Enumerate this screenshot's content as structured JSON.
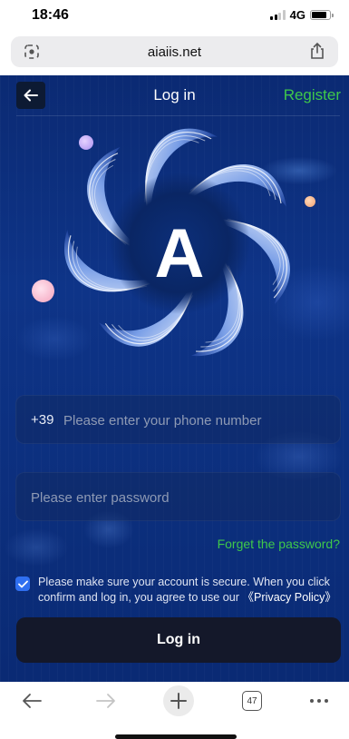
{
  "status_bar": {
    "time": "18:46",
    "network": "4G",
    "battery_level": 0.85
  },
  "browser": {
    "url": "aiaiis.net",
    "tab_count": "47"
  },
  "nav": {
    "title": "Log in",
    "register_label": "Register"
  },
  "logo": {
    "letter": "A"
  },
  "form": {
    "country_code": "+39",
    "phone_placeholder": "Please enter your phone number",
    "password_placeholder": "Please enter password",
    "forgot_label": "Forget the password?",
    "agree_text": "Please make sure your account is secure. When you click confirm and log in, you agree to use our",
    "privacy_label": "《Privacy Policy》",
    "agree_checked": true,
    "login_label": "Log in"
  },
  "colors": {
    "accent_green": "#3fc84a",
    "checkbox_blue": "#2f6ff0",
    "background": "#0c3080",
    "button_dark": "#14182a"
  },
  "icons": [
    "back-arrow-icon",
    "page-menu-icon",
    "share-icon",
    "checkmark-icon",
    "browser-back-icon",
    "browser-forward-icon",
    "plus-icon",
    "tabs-icon",
    "more-icon"
  ]
}
